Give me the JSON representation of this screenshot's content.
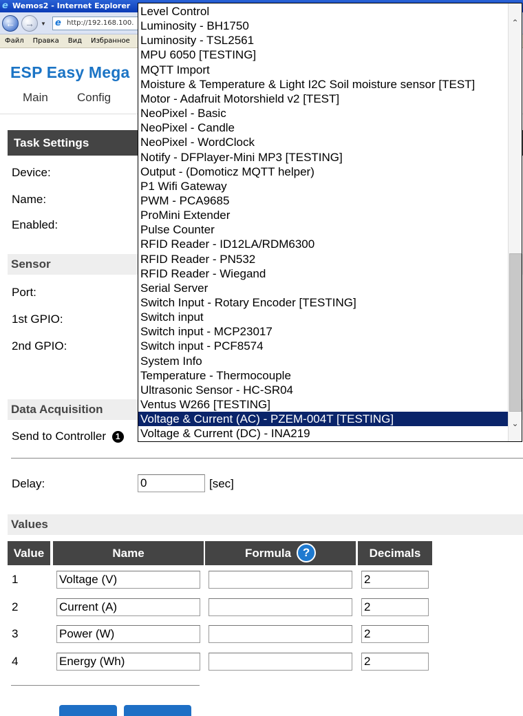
{
  "browser": {
    "title": "Wemos2 - Internet Explorer",
    "address": "http://192.168.100.",
    "menu": [
      "Файл",
      "Правка",
      "Вид",
      "Избранное"
    ]
  },
  "app": {
    "brand": "ESP Easy Mega",
    "nav": [
      "Main",
      "Config"
    ]
  },
  "task_settings": {
    "header": "Task Settings",
    "device_label": "Device:",
    "name_label": "Name:",
    "enabled_label": "Enabled:"
  },
  "sensor": {
    "header": "Sensor",
    "port_label": "Port:",
    "gpio1_label": "1st GPIO:",
    "gpio2_label": "2nd GPIO:"
  },
  "data_acquisition": {
    "header": "Data Acquisition",
    "send_label": "Send to Controller",
    "send_badge": "1",
    "delay_label": "Delay:",
    "delay_value": "0",
    "delay_unit": "[sec]"
  },
  "values": {
    "header": "Values",
    "columns": [
      "Value",
      "Name",
      "Formula",
      "Decimals"
    ],
    "help_glyph": "?",
    "rows": [
      {
        "num": "1",
        "name": "Voltage (V)",
        "formula": "",
        "decimals": "2"
      },
      {
        "num": "2",
        "name": "Current (A)",
        "formula": "",
        "decimals": "2"
      },
      {
        "num": "3",
        "name": "Power (W)",
        "formula": "",
        "decimals": "2"
      },
      {
        "num": "4",
        "name": "Energy (Wh)",
        "formula": "",
        "decimals": "2"
      }
    ]
  },
  "device_dropdown": {
    "selected_index": 28,
    "items": [
      "Level Control",
      "Luminosity - BH1750",
      "Luminosity - TSL2561",
      "MPU 6050 [TESTING]",
      "MQTT Import",
      "Moisture & Temperature & Light I2C Soil moisture sensor [TEST]",
      "Motor - Adafruit Motorshield v2 [TEST]",
      "NeoPixel - Basic",
      "NeoPixel - Candle",
      "NeoPixel - WordClock",
      "Notify - DFPlayer-Mini MP3 [TESTING]",
      "Output - (Domoticz MQTT helper)",
      "P1 Wifi Gateway",
      "PWM - PCA9685",
      "ProMini Extender",
      "Pulse Counter",
      "RFID Reader - ID12LA/RDM6300",
      "RFID Reader - PN532",
      "RFID Reader - Wiegand",
      "Serial Server",
      "Switch Input - Rotary Encoder [TESTING]",
      "Switch input",
      "Switch input - MCP23017",
      "Switch input - PCF8574",
      "System Info",
      "Temperature - Thermocouple",
      "Ultrasonic Sensor - HC-SR04",
      "Ventus W266 [TESTING]",
      "Voltage & Current (AC) - PZEM-004T [TESTING]",
      "Voltage & Current (DC) - INA219"
    ]
  },
  "colors": {
    "brand": "#1b74c5",
    "header_dark": "#444444",
    "selection": "#0a246a"
  }
}
